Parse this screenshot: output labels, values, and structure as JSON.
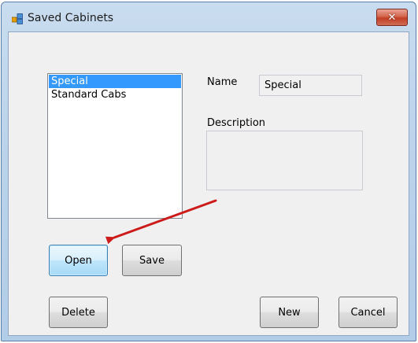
{
  "window": {
    "title": "Saved Cabinets",
    "close_glyph": "✕"
  },
  "list": {
    "items": [
      "Special",
      "Standard Cabs"
    ],
    "selected_index": 0
  },
  "form": {
    "name_label": "Name",
    "name_value": "Special",
    "description_label": "Description",
    "description_value": ""
  },
  "buttons": {
    "open": "Open",
    "save": "Save",
    "delete": "Delete",
    "new": "New",
    "cancel": "Cancel"
  },
  "annotation": {
    "arrow_color": "#cc1b1b"
  },
  "icons": {
    "app": "app-window-icon",
    "close": "close-icon"
  },
  "colors": {
    "selection": "#3399ff",
    "default_button": "#bee6fd"
  }
}
